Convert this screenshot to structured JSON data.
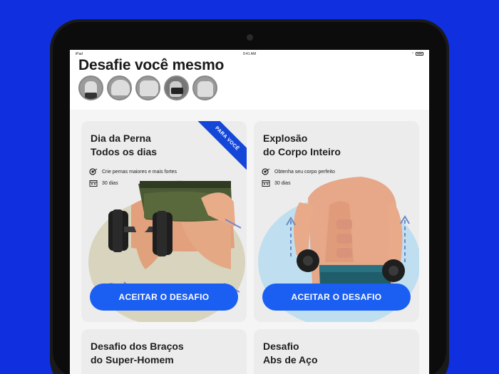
{
  "status": {
    "device": "iPad",
    "time": "9:41 AM"
  },
  "page": {
    "title": "Desafie você mesmo"
  },
  "avatars": [
    "abs",
    "shoulders",
    "chest",
    "glutes",
    "arms"
  ],
  "cards": [
    {
      "title_line1": "Dia da Perna",
      "title_line2": "Todos os dias",
      "goal": "Crie pernas maiores e mais fortes",
      "duration": "30 dias",
      "badge": "PARA VOCÊ",
      "cta": "ACEITAR O DESAFIO"
    },
    {
      "title_line1": "Explosão",
      "title_line2": "do Corpo Inteiro",
      "goal": "Obtenha seu corpo perfeito",
      "duration": "30 dias",
      "cta": "ACEITAR O DESAFIO"
    },
    {
      "title_line1": "Desafio dos Braços",
      "title_line2": "do Super-Homem"
    },
    {
      "title_line1": "Desafio",
      "title_line2": "Abs de Aço"
    }
  ],
  "colors": {
    "background": "#1030e0",
    "accent": "#1a5ff2",
    "ribbon": "#1446d8",
    "card": "#ececec"
  },
  "icons": {
    "goal": "target-icon",
    "duration": "calendar-icon"
  }
}
